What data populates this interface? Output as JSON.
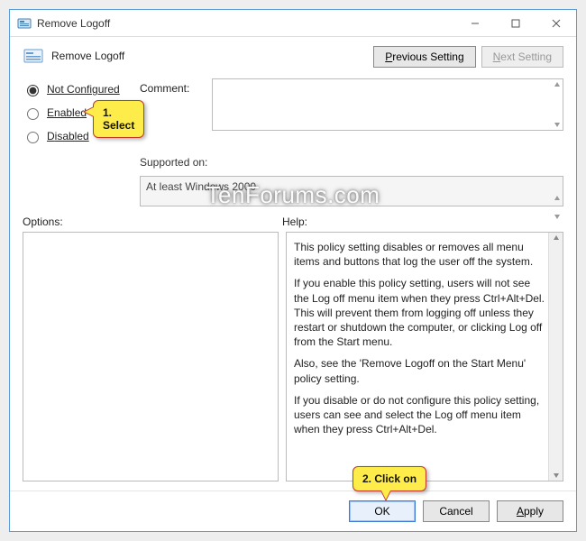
{
  "window": {
    "title": "Remove Logoff"
  },
  "header": {
    "policy_title": "Remove Logoff",
    "prev_btn_pre": "",
    "prev_btn_u": "P",
    "prev_btn_post": "revious Setting",
    "next_btn_pre": "",
    "next_btn_u": "N",
    "next_btn_post": "ext Setting"
  },
  "radios": {
    "not_configured_pre": "Not ",
    "not_configured_u": "C",
    "not_configured_post": "onfigured",
    "enabled_u": "E",
    "enabled_post": "nabled",
    "disabled_u": "D",
    "disabled_post": "isabled",
    "selected": "not_configured"
  },
  "labels": {
    "comment": "Comment:",
    "supported": "Supported on:",
    "options": "Options:",
    "help": "Help:"
  },
  "supported_on": "At least Windows 2000",
  "help": {
    "p1": "This policy setting disables or removes all menu items and buttons that log the user off the system.",
    "p2": "If you enable this policy setting, users will not see the Log off menu item when they press Ctrl+Alt+Del. This will prevent them from logging off unless they restart or shutdown the computer, or clicking Log off from the Start menu.",
    "p3": "Also, see the 'Remove Logoff on the Start Menu' policy setting.",
    "p4": "If you disable or do not configure this policy setting, users can see and select the Log off menu item when they press Ctrl+Alt+Del."
  },
  "footer": {
    "ok": "OK",
    "cancel": "Cancel",
    "apply_u": "A",
    "apply_post": "pply"
  },
  "callouts": {
    "c1": "1. Select",
    "c2": "2. Click on"
  },
  "watermark": "TenForums.com"
}
